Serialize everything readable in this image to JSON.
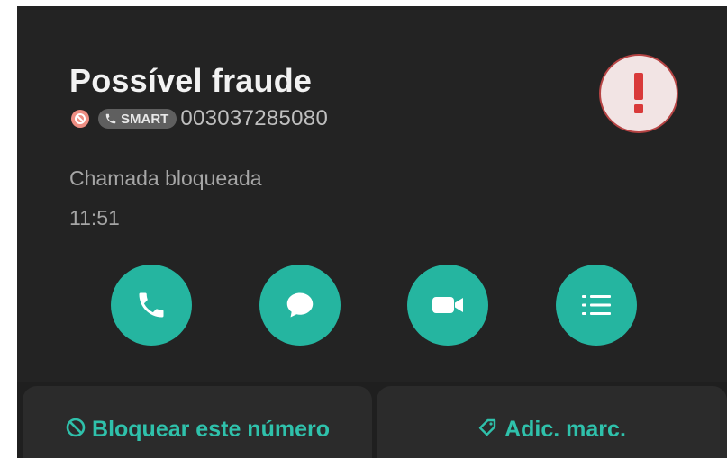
{
  "header": {
    "title": "Possível fraude",
    "smart_label": "SMART",
    "phone_number": "003037285080"
  },
  "call": {
    "status": "Chamada bloqueada",
    "time": "11:51"
  },
  "actions": [
    {
      "name": "call",
      "icon": "phone-icon"
    },
    {
      "name": "message",
      "icon": "message-icon"
    },
    {
      "name": "video",
      "icon": "video-icon"
    },
    {
      "name": "details",
      "icon": "list-icon"
    }
  ],
  "bottom": {
    "block_label": "Bloquear este número",
    "tag_label": "Adic. marc."
  },
  "colors": {
    "accent": "#25b5a0",
    "accent_text": "#2fc1ab",
    "alert_red": "#d93a3a",
    "background": "#232323"
  }
}
